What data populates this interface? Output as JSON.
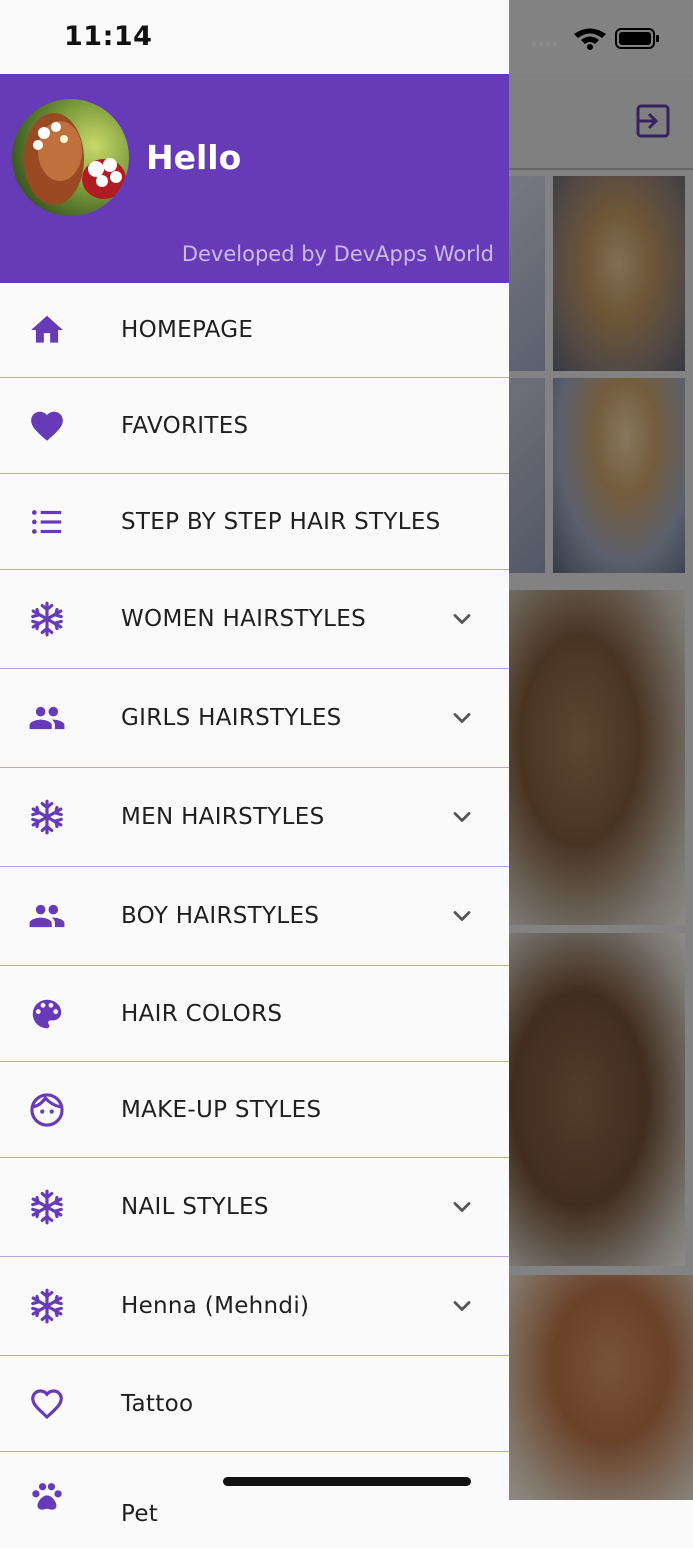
{
  "status_bar": {
    "time": "11:14"
  },
  "drawer": {
    "header": {
      "greeting": "Hello",
      "developer": "Developed by DevApps World"
    },
    "menu": [
      {
        "label": "HOMEPAGE",
        "icon": "home-icon",
        "expandable": false
      },
      {
        "label": "FAVORITES",
        "icon": "heart-icon",
        "expandable": false
      },
      {
        "label": "STEP BY STEP HAIR STYLES",
        "icon": "list-icon",
        "expandable": false
      },
      {
        "label": "WOMEN HAIRSTYLES",
        "icon": "snowflake-icon",
        "expandable": true
      },
      {
        "label": "GIRLS HAIRSTYLES",
        "icon": "people-icon",
        "expandable": true
      },
      {
        "label": "MEN HAIRSTYLES",
        "icon": "snowflake-icon",
        "expandable": true
      },
      {
        "label": "BOY HAIRSTYLES",
        "icon": "people-icon",
        "expandable": true
      },
      {
        "label": "HAIR COLORS",
        "icon": "palette-icon",
        "expandable": false
      },
      {
        "label": "MAKE-UP STYLES",
        "icon": "face-icon",
        "expandable": false
      },
      {
        "label": "NAIL STYLES",
        "icon": "snowflake-icon",
        "expandable": true
      },
      {
        "label": "Henna (Mehndi)",
        "icon": "snowflake-icon",
        "expandable": true
      },
      {
        "label": "Tattoo",
        "icon": "heart-outline-icon",
        "expandable": false
      },
      {
        "label": "Pet",
        "icon": "paw-icon",
        "expandable": false
      }
    ]
  },
  "colors": {
    "accent": "#673ab7",
    "divider": "#b6a6dc"
  }
}
